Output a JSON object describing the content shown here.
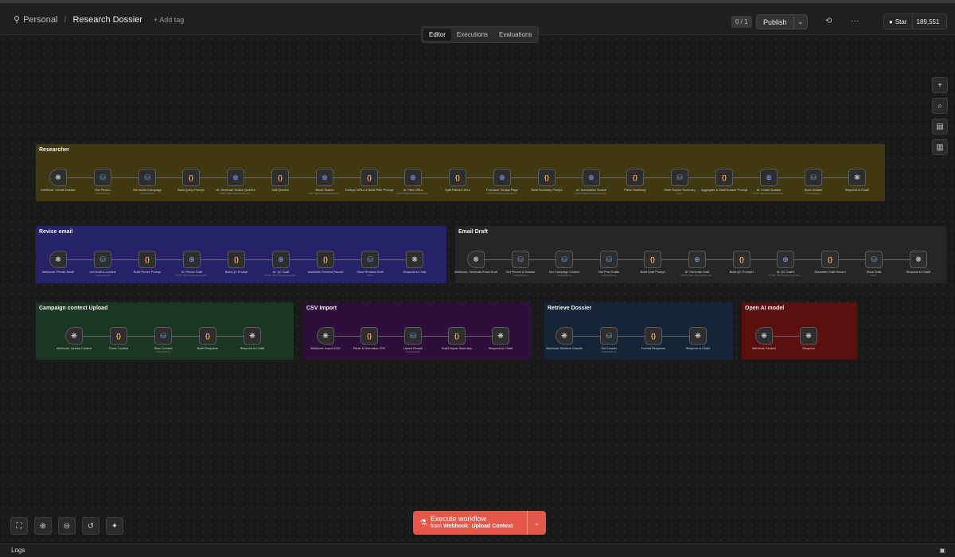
{
  "header": {
    "workspace": "Personal",
    "workflow_title": "Research Dossier",
    "add_tag": "+ Add tag",
    "counter": "0 / 1",
    "publish_label": "Publish",
    "github_star_label": "Star",
    "github_star_count": "189,551"
  },
  "tabs": [
    {
      "label": "Editor",
      "active": true
    },
    {
      "label": "Executions",
      "active": false
    },
    {
      "label": "Evaluations",
      "active": false
    }
  ],
  "groups": {
    "researcher": {
      "title": "Researcher",
      "color": "#3f3810",
      "nodes": [
        {
          "label": "Webhook: Create Dossier",
          "sub": "",
          "icon": "webhook-icon"
        },
        {
          "label": "Get Person",
          "sub": "executeQuery",
          "icon": "database-icon"
        },
        {
          "label": "Get Active Campaign",
          "sub": "executeQuery",
          "icon": "database-icon"
        },
        {
          "label": "Build Query Prompt",
          "sub": "",
          "icon": "code-icon"
        },
        {
          "label": "AI: Generate Search Queries",
          "sub": "POST: https://openrouter.ai/a...",
          "icon": "globe-icon"
        },
        {
          "label": "Split Queries",
          "sub": "",
          "icon": "code-icon"
        },
        {
          "label": "Brave Search",
          "sub": "GET: https://api.search.brave...",
          "icon": "globe-icon"
        },
        {
          "label": "Dedupe URLs & Build Filter Prompt",
          "sub": "",
          "icon": "code-icon"
        },
        {
          "label": "AI: Filter URLs",
          "sub": "POST: https://openrouter.ai/a...",
          "icon": "globe-icon"
        },
        {
          "label": "Split Filtered URLs",
          "sub": "",
          "icon": "code-icon"
        },
        {
          "label": "Firecrawl: Scrape Page",
          "sub": "POST: http://firecrawl-api:1...",
          "icon": "globe-icon"
        },
        {
          "label": "Build Summary Prompt",
          "sub": "",
          "icon": "code-icon"
        },
        {
          "label": "AI: Summarize Source",
          "sub": "POST: https://openrouter.ai/a...",
          "icon": "globe-icon"
        },
        {
          "label": "Parse Summary",
          "sub": "",
          "icon": "code-icon"
        },
        {
          "label": "Store Source Summary",
          "sub": "insert",
          "icon": "database-icon"
        },
        {
          "label": "Aggregate & Build Dossier Prompt",
          "sub": "",
          "icon": "code-icon"
        },
        {
          "label": "AI: Create Dossier",
          "sub": "POST: https://openrouter.ai/a...",
          "icon": "globe-icon"
        },
        {
          "label": "Store Dossier",
          "sub": "executeQuery",
          "icon": "database-icon"
        },
        {
          "label": "Respond to Chat2",
          "sub": "",
          "icon": "webhook-icon"
        }
      ]
    },
    "revise": {
      "title": "Revise email",
      "color": "#26226a",
      "nodes": [
        {
          "label": "Webhook: Revise Email",
          "sub": "",
          "icon": "webhook-icon"
        },
        {
          "label": "Get Draft & Context",
          "sub": "executeQuery",
          "icon": "database-icon"
        },
        {
          "label": "Build Revise Prompt",
          "sub": "",
          "icon": "code-icon"
        },
        {
          "label": "AI: Revise Draft",
          "sub": "POST: https://openrouter.ai/a...",
          "icon": "globe-icon"
        },
        {
          "label": "Build QC Prompt",
          "sub": "",
          "icon": "code-icon"
        },
        {
          "label": "AI: QC Draft",
          "sub": "POST: https://openrouter.ai/a...",
          "icon": "globe-icon"
        },
        {
          "label": "Assemble Revised Record",
          "sub": "",
          "icon": "code-icon"
        },
        {
          "label": "Store Revised Draft",
          "sub": "insert",
          "icon": "database-icon"
        },
        {
          "label": "Respond to Chat",
          "sub": "",
          "icon": "webhook-icon"
        }
      ]
    },
    "email_draft": {
      "title": "Email Draft",
      "color": "#262626",
      "nodes": [
        {
          "label": "Webhook: Generate Email Draft",
          "sub": "",
          "icon": "webhook-icon"
        },
        {
          "label": "Get Person & Dossier",
          "sub": "executeQuery",
          "icon": "database-icon"
        },
        {
          "label": "Get Campaign Context",
          "sub": "executeQuery",
          "icon": "database-icon"
        },
        {
          "label": "Get Prior Drafts",
          "sub": "executeQuery",
          "icon": "database-icon"
        },
        {
          "label": "Build Draft Prompt",
          "sub": "",
          "icon": "code-icon"
        },
        {
          "label": "AI: Generate Draft",
          "sub": "POST: https://openrouter.ai/a...",
          "icon": "globe-icon"
        },
        {
          "label": "Build QC Prompt1",
          "sub": "",
          "icon": "code-icon"
        },
        {
          "label": "AI: QC Draft1",
          "sub": "POST: https://openrouter.ai/a...",
          "icon": "globe-icon"
        },
        {
          "label": "Assemble Draft Record",
          "sub": "",
          "icon": "code-icon"
        },
        {
          "label": "Store Draft",
          "sub": "insert",
          "icon": "database-icon"
        },
        {
          "label": "Respond to Chat3",
          "sub": "",
          "icon": "webhook-icon"
        }
      ]
    },
    "campaign": {
      "title": "Campaign context Upload",
      "color": "#1b3622",
      "nodes": [
        {
          "label": "Webhook: Upload Context",
          "sub": "",
          "icon": "webhook-icon"
        },
        {
          "label": "Parse Context",
          "sub": "",
          "icon": "code-icon"
        },
        {
          "label": "Store Context",
          "sub": "executeQuery",
          "icon": "database-icon"
        },
        {
          "label": "Build Response",
          "sub": "",
          "icon": "code-icon"
        },
        {
          "label": "Respond to Chat5",
          "sub": "",
          "icon": "webhook-icon"
        }
      ]
    },
    "csv": {
      "title": "CSV Import",
      "color": "#2e0f3b",
      "nodes": [
        {
          "label": "Webhook: Import CSV",
          "sub": "",
          "icon": "webhook-icon"
        },
        {
          "label": "Parse & Normalize CSV",
          "sub": "",
          "icon": "code-icon"
        },
        {
          "label": "Upsert People",
          "sub": "executeQuery",
          "icon": "database-icon"
        },
        {
          "label": "Build Import Summary",
          "sub": "",
          "icon": "code-icon"
        },
        {
          "label": "Respond to Chat4",
          "sub": "",
          "icon": "webhook-icon"
        }
      ]
    },
    "retrieve": {
      "title": "Retrieve Dossier",
      "color": "#162438",
      "nodes": [
        {
          "label": "Webhook: Retrieve Dossier",
          "sub": "",
          "icon": "webhook-icon"
        },
        {
          "label": "Get Dossier",
          "sub": "executeQuery",
          "icon": "database-icon"
        },
        {
          "label": "Format Response",
          "sub": "",
          "icon": "code-icon"
        },
        {
          "label": "Respond to Chat1",
          "sub": "",
          "icon": "webhook-icon"
        }
      ]
    },
    "openai": {
      "title": "Open AI model",
      "color": "#5b0f0f",
      "nodes": [
        {
          "label": "Webhook: Models",
          "sub": "",
          "icon": "webhook-icon"
        },
        {
          "label": "Respond",
          "sub": "",
          "icon": "webhook-icon"
        }
      ]
    }
  },
  "execute": {
    "label": "Execute workflow",
    "from_prefix": "from",
    "from_node": "Webhook: Upload Context"
  },
  "logs": {
    "label": "Logs"
  }
}
